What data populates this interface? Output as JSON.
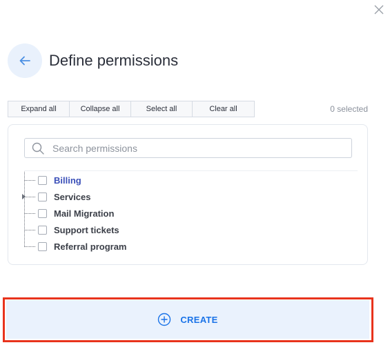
{
  "header": {
    "title": "Define permissions"
  },
  "toolbar": {
    "buttons": [
      {
        "label": "Expand all"
      },
      {
        "label": "Collapse all"
      },
      {
        "label": "Select all"
      },
      {
        "label": "Clear all"
      }
    ],
    "selected_count": "0 selected"
  },
  "search": {
    "placeholder": "Search permissions",
    "value": ""
  },
  "tree": {
    "items": [
      {
        "label": "Billing",
        "checked": false,
        "highlighted": true
      },
      {
        "label": "Services",
        "checked": false,
        "expandable": true
      },
      {
        "label": "Mail Migration",
        "checked": false
      },
      {
        "label": "Support tickets",
        "checked": false
      },
      {
        "label": "Referral program",
        "checked": false
      }
    ]
  },
  "footer": {
    "create_label": "CREATE"
  },
  "colors": {
    "accent": "#1a73e8",
    "highlight_border": "#e8331c",
    "button_bg": "#eaf2fd",
    "link_text": "#3a4fb8"
  },
  "icons": {
    "close": "close-icon",
    "back": "arrow-left-icon",
    "search": "search-icon",
    "create": "plus-circle-icon"
  }
}
